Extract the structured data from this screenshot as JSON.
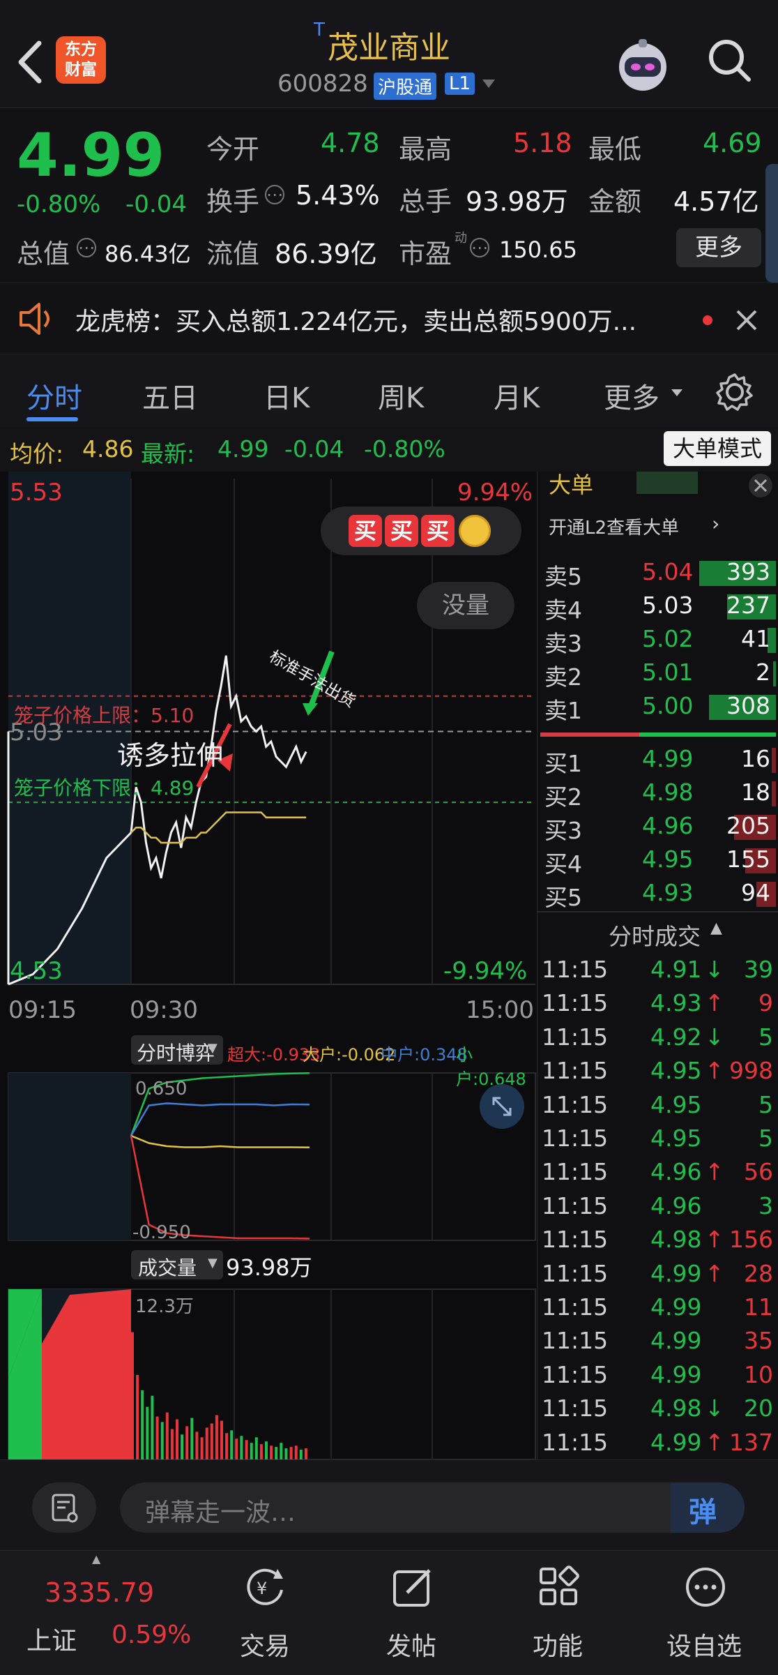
{
  "header": {
    "logo_text": "东方\n财富",
    "title_prefix": "T",
    "title": "茂业商业",
    "code": "600828",
    "badge": "沪股通",
    "level": "L1"
  },
  "quote": {
    "price": "4.99",
    "change_pct": "-0.80%",
    "change": "-0.04",
    "stats": [
      {
        "label": "今开",
        "value": "4.78",
        "color": "#1fbf4e"
      },
      {
        "label": "最高",
        "value": "5.18",
        "color": "#e8363b"
      },
      {
        "label": "最低",
        "value": "4.69",
        "color": "#1fbf4e"
      },
      {
        "label": "换手",
        "value": "5.43%",
        "color": "#f2f2f2"
      },
      {
        "label": "总手",
        "value": "93.98万",
        "color": "#f2f2f2"
      },
      {
        "label": "金额",
        "value": "4.57亿",
        "color": "#f2f2f2"
      },
      {
        "label": "总值",
        "value": "86.43亿",
        "color": "#f2f2f2"
      },
      {
        "label": "流值",
        "value": "86.39亿",
        "color": "#f2f2f2"
      },
      {
        "label": "市盈",
        "value": "150.65",
        "color": "#f2f2f2"
      }
    ],
    "pe_sup": "动",
    "more_button": "更多"
  },
  "notice": {
    "text": "龙虎榜：买入总额1.224亿元，卖出总额5900万..."
  },
  "tabs": [
    "分时",
    "五日",
    "日K",
    "周K",
    "月K",
    "更多"
  ],
  "avg_bar": {
    "avg_label": "均价:",
    "avg_value": "4.86",
    "latest_label": "最新:",
    "latest_value": "4.99",
    "change": "-0.04",
    "change_pct": "-0.80%",
    "mode_button": "大单模式"
  },
  "chart": {
    "y_top": "5.53",
    "y_bottom": "4.53",
    "pct_top": "9.94%",
    "pct_bottom": "-9.94%",
    "prev_close_label": "5.03",
    "x_labels": [
      "09:15",
      "09:30",
      "15:00"
    ],
    "buy_buttons": [
      "买",
      "买",
      "买"
    ],
    "volume_toggle": "没量",
    "upper_limit": "笼子价格上限：5.10",
    "lower_limit": "笼子价格下限：4.89",
    "annotation_1": "诱多拉伸",
    "annotation_2": "标准手法出货",
    "flow_title": "分时博弈",
    "flow_legend": [
      {
        "label": "超大:-0.933",
        "color": "#e8363b"
      },
      {
        "label": "大户:-0.062",
        "color": "#e3c242"
      },
      {
        "label": "中户:0.348",
        "color": "#3f7fd6"
      },
      {
        "label": "小户:0.648",
        "color": "#1fbf4e"
      }
    ],
    "flow_top": "0.650",
    "flow_bottom": "-0.950",
    "vol_title": "成交量",
    "vol_total": "93.98万",
    "vol_max": "12.3万"
  },
  "chart_data": {
    "type": "line",
    "x": [
      "09:30",
      "09:33",
      "09:36",
      "09:39",
      "09:42",
      "09:45",
      "09:48",
      "09:51",
      "09:54",
      "09:57",
      "10:00",
      "10:03",
      "10:06",
      "10:09",
      "10:12",
      "10:15",
      "10:18",
      "10:21",
      "10:24",
      "10:27",
      "10:30",
      "10:33",
      "10:36",
      "10:39",
      "10:42",
      "10:45",
      "10:48",
      "10:51",
      "10:54",
      "10:57",
      "11:00",
      "11:03",
      "11:06",
      "11:09",
      "11:12",
      "11:15"
    ],
    "series": [
      {
        "name": "price",
        "values": [
          4.83,
          4.92,
          4.89,
          4.81,
          4.76,
          4.78,
          4.74,
          4.79,
          4.83,
          4.85,
          4.8,
          4.86,
          4.84,
          4.89,
          4.93,
          4.94,
          5.0,
          5.07,
          5.12,
          5.18,
          5.08,
          5.1,
          5.05,
          5.06,
          5.04,
          5.03,
          5.04,
          5.0,
          5.01,
          4.98,
          4.97,
          4.96,
          4.98,
          5.0,
          4.97,
          4.99
        ]
      },
      {
        "name": "avg",
        "values": [
          4.83,
          4.84,
          4.84,
          4.83,
          4.82,
          4.82,
          4.81,
          4.81,
          4.81,
          4.81,
          4.81,
          4.82,
          4.82,
          4.82,
          4.83,
          4.83,
          4.84,
          4.85,
          4.86,
          4.87,
          4.87,
          4.87,
          4.87,
          4.87,
          4.87,
          4.87,
          4.87,
          4.86,
          4.86,
          4.86,
          4.86,
          4.86,
          4.86,
          4.86,
          4.86,
          4.86
        ]
      }
    ],
    "ylim": [
      4.53,
      5.53
    ],
    "prev_close": 5.03,
    "auction_x": [
      "09:15",
      "09:17",
      "09:19",
      "09:21",
      "09:23",
      "09:25"
    ],
    "auction_values": [
      4.53,
      4.55,
      4.6,
      4.68,
      4.78,
      4.83
    ]
  },
  "orderbook": {
    "l2_title": "大单",
    "l2_link": "开通L2查看大单",
    "asks": [
      {
        "label": "卖5",
        "price": "5.04",
        "vol": "393",
        "pcolor": "#e8363b",
        "bar": 0.55
      },
      {
        "label": "卖4",
        "price": "5.03",
        "vol": "237",
        "pcolor": "#f2f2f2",
        "bar": 0.35
      },
      {
        "label": "卖3",
        "price": "5.02",
        "vol": "41",
        "pcolor": "#1fbf4e",
        "bar": 0.06
      },
      {
        "label": "卖2",
        "price": "5.01",
        "vol": "2",
        "pcolor": "#1fbf4e",
        "bar": 0.01
      },
      {
        "label": "卖1",
        "price": "5.00",
        "vol": "308",
        "pcolor": "#1fbf4e",
        "bar": 0.48
      }
    ],
    "bids": [
      {
        "label": "买1",
        "price": "4.99",
        "vol": "16",
        "pcolor": "#1fbf4e",
        "bar": 0.03
      },
      {
        "label": "买2",
        "price": "4.98",
        "vol": "18",
        "pcolor": "#1fbf4e",
        "bar": 0.03
      },
      {
        "label": "买3",
        "price": "4.96",
        "vol": "205",
        "pcolor": "#1fbf4e",
        "bar": 0.3
      },
      {
        "label": "买4",
        "price": "4.95",
        "vol": "155",
        "pcolor": "#1fbf4e",
        "bar": 0.22
      },
      {
        "label": "买5",
        "price": "4.93",
        "vol": "94",
        "pcolor": "#1fbf4e",
        "bar": 0.14
      }
    ]
  },
  "trades": {
    "title": "分时成交",
    "rows": [
      {
        "time": "11:15",
        "price": "4.91",
        "arrow": "↓",
        "vol": "39",
        "pcolor": "#1fbf4e",
        "vcolor": "#1fbf4e"
      },
      {
        "time": "11:15",
        "price": "4.93",
        "arrow": "↑",
        "vol": "9",
        "pcolor": "#1fbf4e",
        "vcolor": "#e8363b"
      },
      {
        "time": "11:15",
        "price": "4.92",
        "arrow": "↓",
        "vol": "5",
        "pcolor": "#1fbf4e",
        "vcolor": "#1fbf4e"
      },
      {
        "time": "11:15",
        "price": "4.95",
        "arrow": "↑",
        "vol": "998",
        "pcolor": "#1fbf4e",
        "vcolor": "#e8363b"
      },
      {
        "time": "11:15",
        "price": "4.95",
        "arrow": "",
        "vol": "5",
        "pcolor": "#1fbf4e",
        "vcolor": "#1fbf4e"
      },
      {
        "time": "11:15",
        "price": "4.95",
        "arrow": "",
        "vol": "5",
        "pcolor": "#1fbf4e",
        "vcolor": "#1fbf4e"
      },
      {
        "time": "11:15",
        "price": "4.96",
        "arrow": "↑",
        "vol": "56",
        "pcolor": "#1fbf4e",
        "vcolor": "#e8363b"
      },
      {
        "time": "11:15",
        "price": "4.96",
        "arrow": "",
        "vol": "3",
        "pcolor": "#1fbf4e",
        "vcolor": "#1fbf4e"
      },
      {
        "time": "11:15",
        "price": "4.98",
        "arrow": "↑",
        "vol": "156",
        "pcolor": "#1fbf4e",
        "vcolor": "#e8363b"
      },
      {
        "time": "11:15",
        "price": "4.99",
        "arrow": "↑",
        "vol": "28",
        "pcolor": "#1fbf4e",
        "vcolor": "#e8363b"
      },
      {
        "time": "11:15",
        "price": "4.99",
        "arrow": "",
        "vol": "11",
        "pcolor": "#1fbf4e",
        "vcolor": "#e8363b"
      },
      {
        "time": "11:15",
        "price": "4.99",
        "arrow": "",
        "vol": "35",
        "pcolor": "#1fbf4e",
        "vcolor": "#e8363b"
      },
      {
        "time": "11:15",
        "price": "4.99",
        "arrow": "",
        "vol": "10",
        "pcolor": "#1fbf4e",
        "vcolor": "#e8363b"
      },
      {
        "time": "11:15",
        "price": "4.98",
        "arrow": "↓",
        "vol": "20",
        "pcolor": "#1fbf4e",
        "vcolor": "#1fbf4e"
      },
      {
        "time": "11:15",
        "price": "4.99",
        "arrow": "↑",
        "vol": "137",
        "pcolor": "#1fbf4e",
        "vcolor": "#e8363b"
      }
    ]
  },
  "danmu": {
    "placeholder": "弹幕走一波…",
    "send_glyph": "弹"
  },
  "nav": {
    "index_value": "3335.79",
    "index_name": "上证",
    "index_change": "0.59%",
    "items": [
      "交易",
      "发帖",
      "功能",
      "设自选"
    ]
  }
}
